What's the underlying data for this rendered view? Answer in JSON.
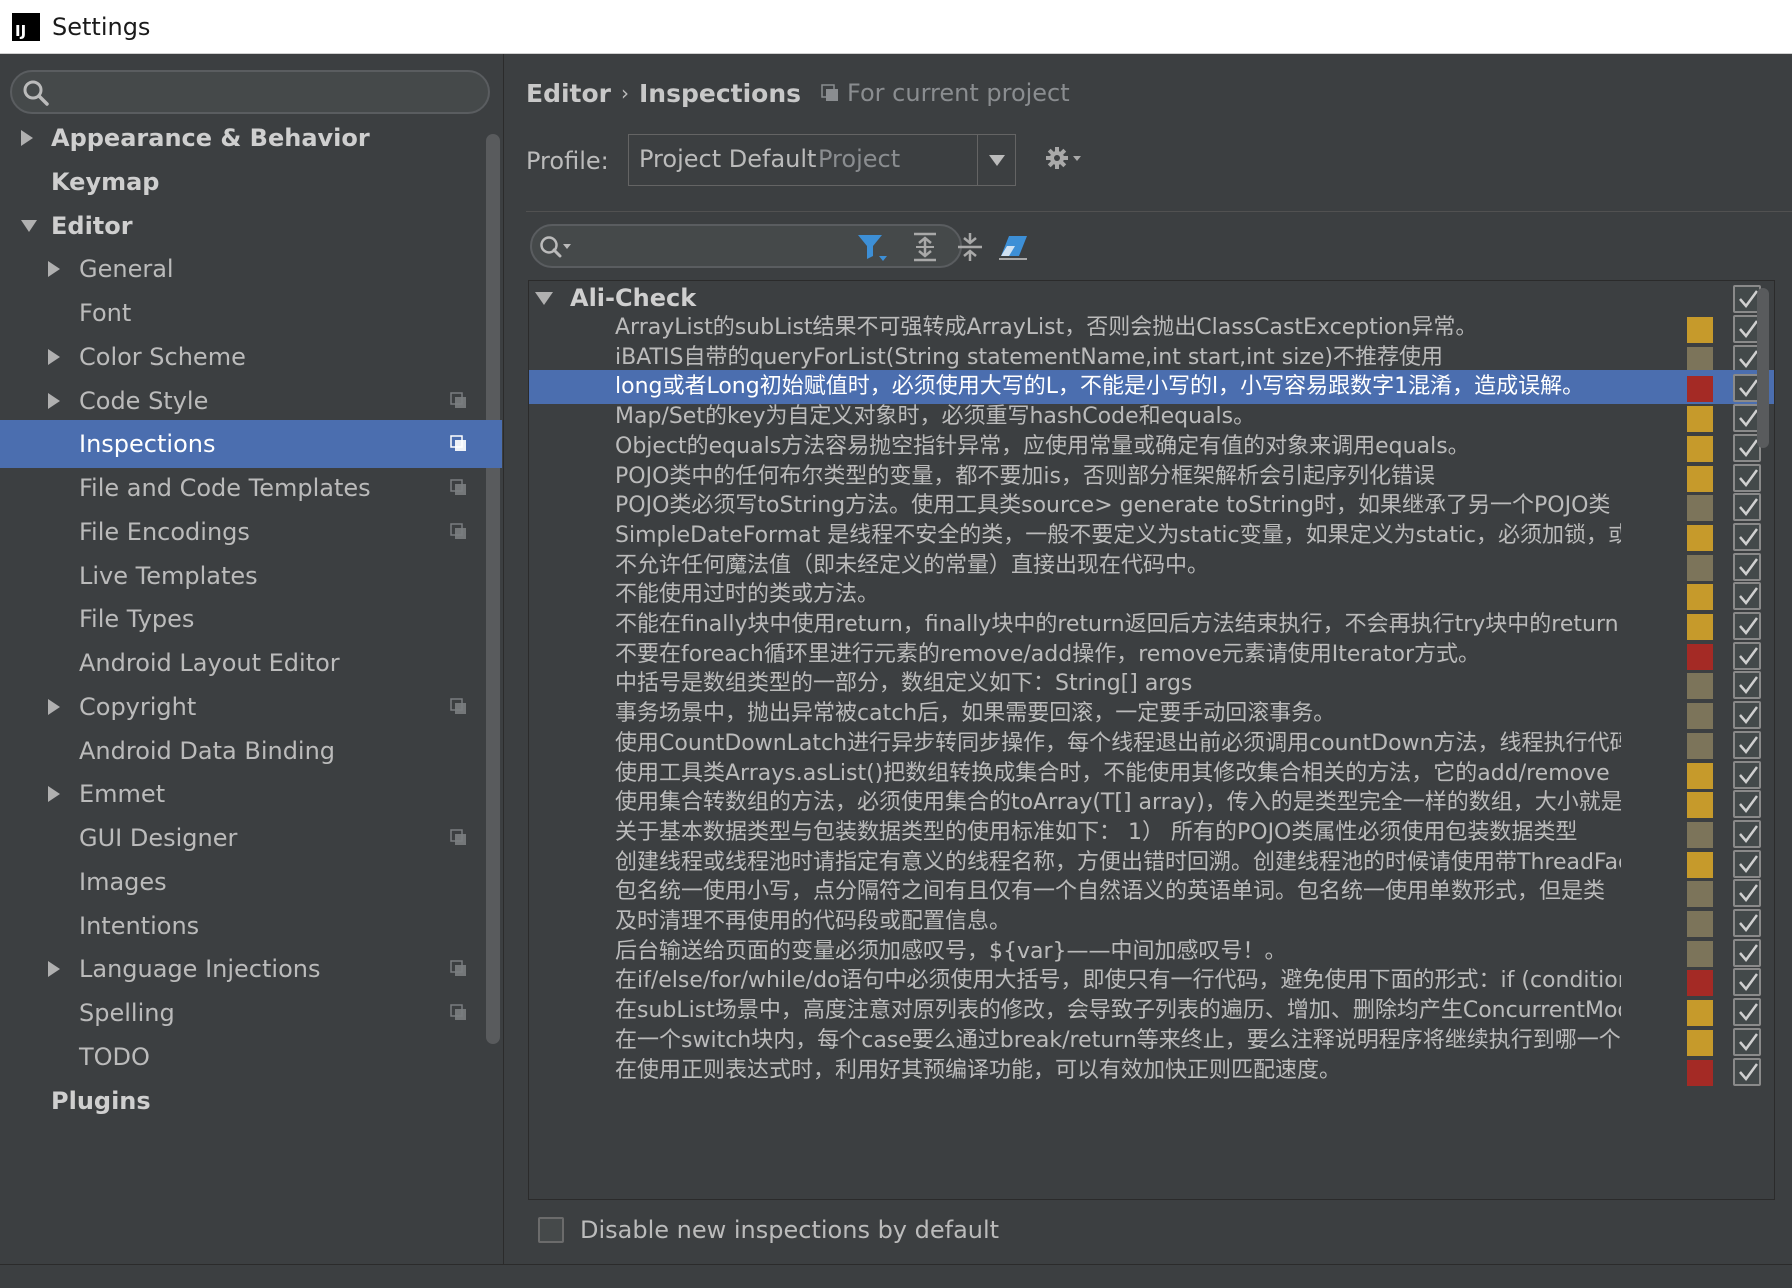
{
  "window": {
    "title": "Settings",
    "app_icon_text": "IJ"
  },
  "sidebar": {
    "search": {
      "placeholder": "",
      "value": ""
    },
    "items": [
      {
        "label": "Appearance & Behavior",
        "level": 0,
        "arrow": "right",
        "bold": true,
        "selected": false,
        "project_icon": false
      },
      {
        "label": "Keymap",
        "level": 0,
        "arrow": "none",
        "bold": true,
        "selected": false,
        "project_icon": false
      },
      {
        "label": "Editor",
        "level": 0,
        "arrow": "down",
        "bold": true,
        "selected": false,
        "project_icon": false
      },
      {
        "label": "General",
        "level": 1,
        "arrow": "right",
        "bold": false,
        "selected": false,
        "project_icon": false
      },
      {
        "label": "Font",
        "level": 1,
        "arrow": "none",
        "bold": false,
        "selected": false,
        "project_icon": false
      },
      {
        "label": "Color Scheme",
        "level": 1,
        "arrow": "right",
        "bold": false,
        "selected": false,
        "project_icon": false
      },
      {
        "label": "Code Style",
        "level": 1,
        "arrow": "right",
        "bold": false,
        "selected": false,
        "project_icon": true
      },
      {
        "label": "Inspections",
        "level": 1,
        "arrow": "none",
        "bold": false,
        "selected": true,
        "project_icon": true
      },
      {
        "label": "File and Code Templates",
        "level": 1,
        "arrow": "none",
        "bold": false,
        "selected": false,
        "project_icon": true
      },
      {
        "label": "File Encodings",
        "level": 1,
        "arrow": "none",
        "bold": false,
        "selected": false,
        "project_icon": true
      },
      {
        "label": "Live Templates",
        "level": 1,
        "arrow": "none",
        "bold": false,
        "selected": false,
        "project_icon": false
      },
      {
        "label": "File Types",
        "level": 1,
        "arrow": "none",
        "bold": false,
        "selected": false,
        "project_icon": false
      },
      {
        "label": "Android Layout Editor",
        "level": 1,
        "arrow": "none",
        "bold": false,
        "selected": false,
        "project_icon": false
      },
      {
        "label": "Copyright",
        "level": 1,
        "arrow": "right",
        "bold": false,
        "selected": false,
        "project_icon": true
      },
      {
        "label": "Android Data Binding",
        "level": 1,
        "arrow": "none",
        "bold": false,
        "selected": false,
        "project_icon": false
      },
      {
        "label": "Emmet",
        "level": 1,
        "arrow": "right",
        "bold": false,
        "selected": false,
        "project_icon": false
      },
      {
        "label": "GUI Designer",
        "level": 1,
        "arrow": "none",
        "bold": false,
        "selected": false,
        "project_icon": true
      },
      {
        "label": "Images",
        "level": 1,
        "arrow": "none",
        "bold": false,
        "selected": false,
        "project_icon": false
      },
      {
        "label": "Intentions",
        "level": 1,
        "arrow": "none",
        "bold": false,
        "selected": false,
        "project_icon": false
      },
      {
        "label": "Language Injections",
        "level": 1,
        "arrow": "right",
        "bold": false,
        "selected": false,
        "project_icon": true
      },
      {
        "label": "Spelling",
        "level": 1,
        "arrow": "none",
        "bold": false,
        "selected": false,
        "project_icon": true
      },
      {
        "label": "TODO",
        "level": 1,
        "arrow": "none",
        "bold": false,
        "selected": false,
        "project_icon": false
      },
      {
        "label": "Plugins",
        "level": 0,
        "arrow": "none",
        "bold": true,
        "selected": false,
        "project_icon": false
      }
    ]
  },
  "main": {
    "breadcrumb": {
      "editor": "Editor",
      "separator": "›",
      "inspections": "Inspections",
      "scope": "For current project"
    },
    "profile": {
      "label": "Profile:",
      "name": "Project Default",
      "scope": "Project"
    },
    "filter": {
      "placeholder": "",
      "value": ""
    },
    "group": {
      "name": "Ali-Check",
      "checked": true
    },
    "severity_colors": {
      "warning": "#c69a2b",
      "weak": "#7c745a",
      "error": "#a42a25"
    },
    "inspections": [
      {
        "text": "ArrayList的subList结果不可强转成ArrayList，否则会抛出ClassCastException异常。",
        "severity": "warning",
        "checked": true,
        "selected": false
      },
      {
        "text": "iBATIS自带的queryForList(String statementName,int start,int size)不推荐使用",
        "severity": "weak",
        "checked": true,
        "selected": false
      },
      {
        "text": "long或者Long初始赋值时，必须使用大写的L，不能是小写的l，小写容易跟数字1混淆，造成误解。",
        "severity": "error",
        "checked": true,
        "selected": true
      },
      {
        "text": "Map/Set的key为自定义对象时，必须重写hashCode和equals。",
        "severity": "warning",
        "checked": true,
        "selected": false
      },
      {
        "text": "Object的equals方法容易抛空指针异常，应使用常量或确定有值的对象来调用equals。",
        "severity": "warning",
        "checked": true,
        "selected": false
      },
      {
        "text": "POJO类中的任何布尔类型的变量，都不要加is，否则部分框架解析会引起序列化错误",
        "severity": "warning",
        "checked": true,
        "selected": false
      },
      {
        "text": "POJO类必须写toString方法。使用工具类source> generate toString时，如果继承了另一个POJO类",
        "severity": "weak",
        "checked": true,
        "selected": false
      },
      {
        "text": "SimpleDateFormat 是线程不安全的类，一般不要定义为static变量，如果定义为static，必须加锁，或",
        "severity": "warning",
        "checked": true,
        "selected": false
      },
      {
        "text": "不允许任何魔法值（即未经定义的常量）直接出现在代码中。",
        "severity": "weak",
        "checked": true,
        "selected": false
      },
      {
        "text": "不能使用过时的类或方法。",
        "severity": "warning",
        "checked": true,
        "selected": false
      },
      {
        "text": "不能在finally块中使用return，finally块中的return返回后方法结束执行，不会再执行try块中的return",
        "severity": "warning",
        "checked": true,
        "selected": false
      },
      {
        "text": "不要在foreach循环里进行元素的remove/add操作，remove元素请使用Iterator方式。",
        "severity": "error",
        "checked": true,
        "selected": false
      },
      {
        "text": "中括号是数组类型的一部分，数组定义如下：String[] args",
        "severity": "weak",
        "checked": true,
        "selected": false
      },
      {
        "text": "事务场景中，抛出异常被catch后，如果需要回滚，一定要手动回滚事务。",
        "severity": "weak",
        "checked": true,
        "selected": false
      },
      {
        "text": "使用CountDownLatch进行异步转同步操作，每个线程退出前必须调用countDown方法，线程执行代码",
        "severity": "weak",
        "checked": true,
        "selected": false
      },
      {
        "text": "使用工具类Arrays.asList()把数组转换成集合时，不能使用其修改集合相关的方法，它的add/remove",
        "severity": "warning",
        "checked": true,
        "selected": false
      },
      {
        "text": "使用集合转数组的方法，必须使用集合的toArray(T[] array)，传入的是类型完全一样的数组，大小就是",
        "severity": "warning",
        "checked": true,
        "selected": false
      },
      {
        "text": "关于基本数据类型与包装数据类型的使用标准如下：    1） 所有的POJO类属性必须使用包装数据类型",
        "severity": "weak",
        "checked": true,
        "selected": false
      },
      {
        "text": "创建线程或线程池时请指定有意义的线程名称，方便出错时回溯。创建线程池的时候请使用带ThreadFactory",
        "severity": "warning",
        "checked": true,
        "selected": false
      },
      {
        "text": "包名统一使用小写，点分隔符之间有且仅有一个自然语义的英语单词。包名统一使用单数形式，但是类",
        "severity": "weak",
        "checked": true,
        "selected": false
      },
      {
        "text": "及时清理不再使用的代码段或配置信息。",
        "severity": "weak",
        "checked": true,
        "selected": false
      },
      {
        "text": "后台输送给页面的变量必须加感叹号，${var}——中间加感叹号！。",
        "severity": "weak",
        "checked": true,
        "selected": false
      },
      {
        "text": "在if/else/for/while/do语句中必须使用大括号，即使只有一行代码，避免使用下面的形式：if (condition)",
        "severity": "error",
        "checked": true,
        "selected": false
      },
      {
        "text": "在subList场景中，高度注意对原列表的修改，会导致子列表的遍历、增加、删除均产生ConcurrentModification",
        "severity": "warning",
        "checked": true,
        "selected": false
      },
      {
        "text": "在一个switch块内，每个case要么通过break/return等来终止，要么注释说明程序将继续执行到哪一个",
        "severity": "warning",
        "checked": true,
        "selected": false
      },
      {
        "text": "在使用正则表达式时，利用好其预编译功能，可以有效加快正则匹配速度。",
        "severity": "error",
        "checked": true,
        "selected": false
      }
    ],
    "disable_new": {
      "label": "Disable new inspections by default",
      "checked": false
    }
  }
}
